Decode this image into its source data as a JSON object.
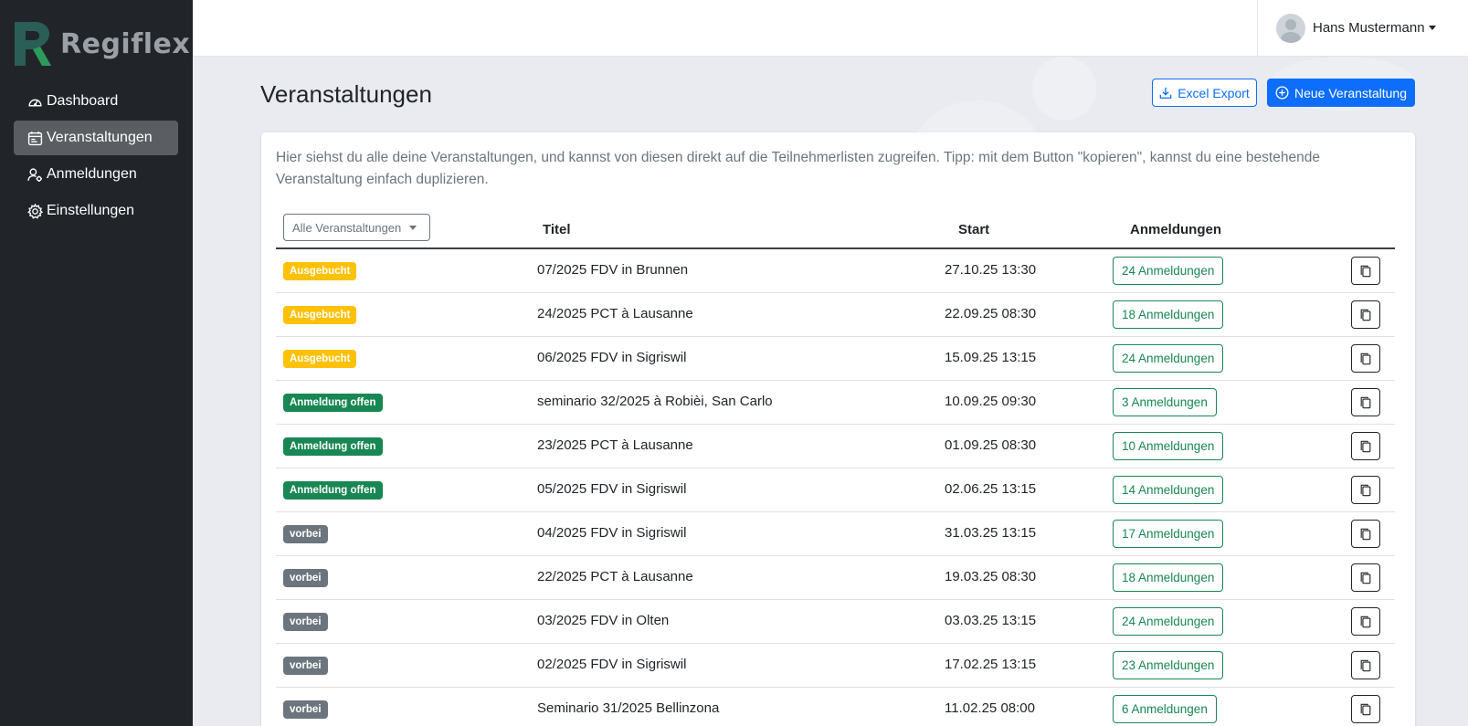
{
  "app": {
    "name": "Regiflex"
  },
  "sidebar": {
    "items": [
      {
        "label": "Dashboard",
        "icon": "speedometer-icon",
        "active": false
      },
      {
        "label": "Veranstaltungen",
        "icon": "calendar-icon",
        "active": true
      },
      {
        "label": "Anmeldungen",
        "icon": "person-gear-icon",
        "active": false
      },
      {
        "label": "Einstellungen",
        "icon": "gear-icon",
        "active": false
      }
    ]
  },
  "user": {
    "name": "Hans Mustermann"
  },
  "header": {
    "title": "Veranstaltungen",
    "export_label": "Excel Export",
    "new_label": "Neue Veranstaltung"
  },
  "intro": "Hier siehst du alle deine Veranstaltungen, und kannst von diesen direkt auf die Teilnehmerlisten zugreifen. Tipp: mit dem Button \"kopieren\", kannst du eine bestehende Veranstaltung einfach duplizieren.",
  "table": {
    "filter": "Alle Veranstaltungen",
    "headers": {
      "title": "Titel",
      "start": "Start",
      "registrations": "Anmeldungen"
    },
    "rows": [
      {
        "status": "Ausgebucht",
        "status_type": "ausgebucht",
        "title": "07/2025 FDV in Brunnen",
        "start": "27.10.25 13:30",
        "registrations": "24 Anmeldungen"
      },
      {
        "status": "Ausgebucht",
        "status_type": "ausgebucht",
        "title": "24/2025 PCT à Lausanne",
        "start": "22.09.25 08:30",
        "registrations": "18 Anmeldungen"
      },
      {
        "status": "Ausgebucht",
        "status_type": "ausgebucht",
        "title": "06/2025 FDV in Sigriswil",
        "start": "15.09.25 13:15",
        "registrations": "24 Anmeldungen"
      },
      {
        "status": "Anmeldung offen",
        "status_type": "offen",
        "title": "seminario 32/2025 à Robièi, San Carlo",
        "start": "10.09.25 09:30",
        "registrations": "3 Anmeldungen"
      },
      {
        "status": "Anmeldung offen",
        "status_type": "offen",
        "title": "23/2025 PCT à Lausanne",
        "start": "01.09.25 08:30",
        "registrations": "10 Anmeldungen"
      },
      {
        "status": "Anmeldung offen",
        "status_type": "offen",
        "title": "05/2025 FDV in Sigriswil",
        "start": "02.06.25 13:15",
        "registrations": "14 Anmeldungen"
      },
      {
        "status": "vorbei",
        "status_type": "vorbei",
        "title": "04/2025 FDV in Sigriswil",
        "start": "31.03.25 13:15",
        "registrations": "17 Anmeldungen"
      },
      {
        "status": "vorbei",
        "status_type": "vorbei",
        "title": "22/2025 PCT à Lausanne",
        "start": "19.03.25 08:30",
        "registrations": "18 Anmeldungen"
      },
      {
        "status": "vorbei",
        "status_type": "vorbei",
        "title": "03/2025 FDV in Olten",
        "start": "03.03.25 13:15",
        "registrations": "24 Anmeldungen"
      },
      {
        "status": "vorbei",
        "status_type": "vorbei",
        "title": "02/2025 FDV in Sigriswil",
        "start": "17.02.25 13:15",
        "registrations": "23 Anmeldungen"
      },
      {
        "status": "vorbei",
        "status_type": "vorbei",
        "title": "Seminario 31/2025 Bellinzona",
        "start": "11.02.25 08:00",
        "registrations": "6 Anmeldungen"
      }
    ]
  },
  "colors": {
    "sidebar_bg": "#212529",
    "primary": "#0d6efd",
    "success": "#198754",
    "warning": "#ffc107",
    "secondary": "#6c757d"
  }
}
